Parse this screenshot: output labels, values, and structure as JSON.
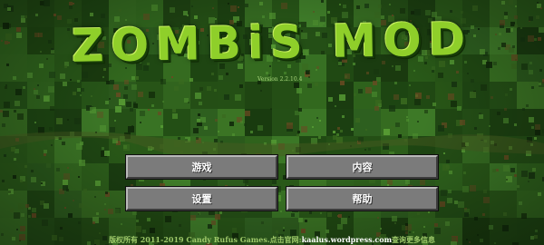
{
  "game": {
    "title": "ZOMBiS MOD",
    "version": "Version 2.2.10.4"
  },
  "menu": {
    "play_label": "游戏",
    "content_label": "内容",
    "settings_label": "设置",
    "help_label": "帮助"
  },
  "footer": {
    "prefix": "版权所有 2011-2019 Candy Rufus Games.点击官网:",
    "link": "kaalus.wordpress.com",
    "suffix": "查询更多信息"
  },
  "colors": {
    "background": "#1f4a14",
    "title": "#8fcf2a",
    "button": "#7b7b7b",
    "footer_text": "#9ec96a"
  }
}
